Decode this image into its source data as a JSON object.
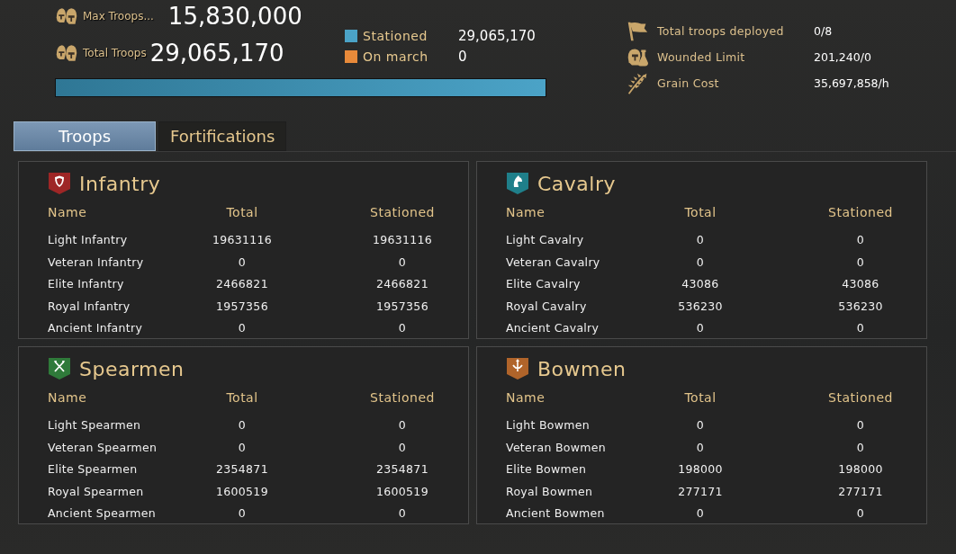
{
  "summary": {
    "stats": [
      {
        "label": "Max Troops...",
        "value": "15,830,000"
      },
      {
        "label": "Total Troops",
        "value": "29,065,170"
      }
    ],
    "legend": [
      {
        "label": "Stationed",
        "value": "29,065,170",
        "color": "#4ba3c7"
      },
      {
        "label": "On march",
        "value": "0",
        "color": "#e88a3a"
      }
    ],
    "bar": {
      "level": 1
    },
    "details": [
      {
        "kind": "flag",
        "label": "Total troops deployed",
        "value": "0/8"
      },
      {
        "kind": "wounded",
        "label": "Wounded Limit",
        "value": "201,240/0"
      },
      {
        "kind": "grain",
        "label": "Grain Cost",
        "value": "35,697,858/h"
      }
    ]
  },
  "tabs": [
    {
      "label": "Troops",
      "selected": true
    },
    {
      "label": "Fortifications",
      "selected": false
    }
  ],
  "panels": [
    {
      "title": "Infantry",
      "kind": "shield",
      "color": "#9e2626",
      "columns": [
        "Name",
        "Total",
        "Stationed"
      ],
      "rows": [
        [
          "Light Infantry",
          "19631116",
          "19631116"
        ],
        [
          "Veteran Infantry",
          "0",
          "0"
        ],
        [
          "Elite Infantry",
          "2466821",
          "2466821"
        ],
        [
          "Royal Infantry",
          "1957356",
          "1957356"
        ],
        [
          "Ancient Infantry",
          "0",
          "0"
        ]
      ]
    },
    {
      "title": "Cavalry",
      "kind": "horse",
      "color": "#1f7f8a",
      "columns": [
        "Name",
        "Total",
        "Stationed"
      ],
      "rows": [
        [
          "Light Cavalry",
          "0",
          "0"
        ],
        [
          "Veteran Cavalry",
          "0",
          "0"
        ],
        [
          "Elite Cavalry",
          "43086",
          "43086"
        ],
        [
          "Royal Cavalry",
          "536230",
          "536230"
        ],
        [
          "Ancient Cavalry",
          "0",
          "0"
        ]
      ]
    },
    {
      "title": "Spearmen",
      "kind": "spear",
      "color": "#2f7a3a",
      "columns": [
        "Name",
        "Total",
        "Stationed"
      ],
      "rows": [
        [
          "Light Spearmen",
          "0",
          "0"
        ],
        [
          "Veteran Spearmen",
          "0",
          "0"
        ],
        [
          "Elite Spearmen",
          "2354871",
          "2354871"
        ],
        [
          "Royal Spearmen",
          "1600519",
          "1600519"
        ],
        [
          "Ancient Spearmen",
          "0",
          "0"
        ]
      ]
    },
    {
      "title": "Bowmen",
      "kind": "bow",
      "color": "#b0642a",
      "columns": [
        "Name",
        "Total",
        "Stationed"
      ],
      "rows": [
        [
          "Light Bowmen",
          "0",
          "0"
        ],
        [
          "Veteran Bowmen",
          "0",
          "0"
        ],
        [
          "Elite Bowmen",
          "198000",
          "198000"
        ],
        [
          "Royal Bowmen",
          "277171",
          "277171"
        ],
        [
          "Ancient Bowmen",
          "0",
          "0"
        ]
      ]
    }
  ]
}
